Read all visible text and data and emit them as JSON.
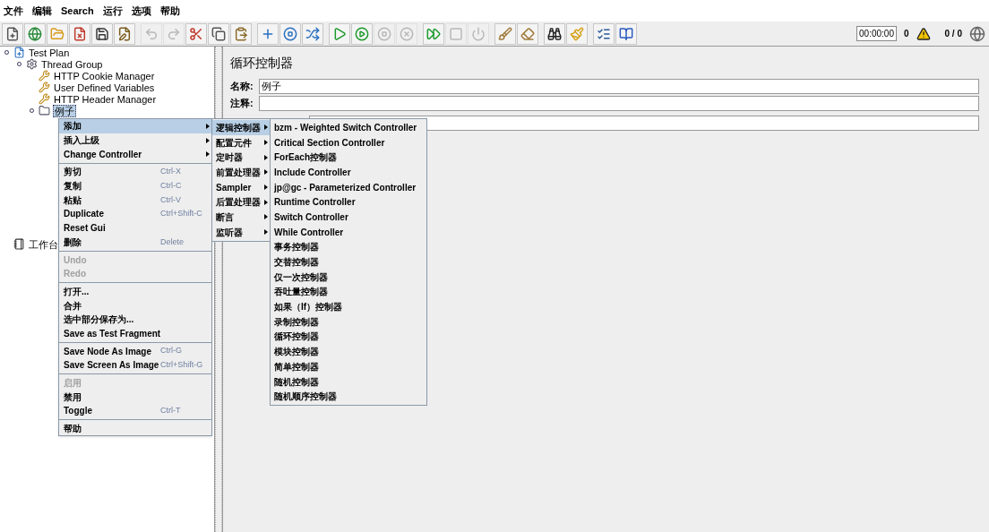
{
  "menu_bar": [
    {
      "label": "文件"
    },
    {
      "label": "编辑"
    },
    {
      "label": "Search"
    },
    {
      "label": "运行"
    },
    {
      "label": "选项"
    },
    {
      "label": "帮助"
    }
  ],
  "toolbar": [
    [
      {
        "kind": "new",
        "disabled": false
      },
      {
        "kind": "templates",
        "disabled": false
      },
      {
        "kind": "open",
        "disabled": false
      },
      {
        "kind": "close",
        "disabled": false
      },
      {
        "kind": "save",
        "disabled": false
      },
      {
        "kind": "save-as",
        "disabled": false
      }
    ],
    [
      {
        "kind": "undo",
        "disabled": true
      },
      {
        "kind": "redo",
        "disabled": true
      },
      {
        "kind": "cut",
        "disabled": false
      },
      {
        "kind": "copy",
        "disabled": false
      },
      {
        "kind": "paste",
        "disabled": false
      }
    ],
    [
      {
        "kind": "expand",
        "disabled": false
      },
      {
        "kind": "collapse",
        "disabled": false
      },
      {
        "kind": "toggle",
        "disabled": false
      }
    ],
    [
      {
        "kind": "start",
        "disabled": false
      },
      {
        "kind": "start-no-pause",
        "disabled": false
      },
      {
        "kind": "stop",
        "disabled": true
      },
      {
        "kind": "shutdown",
        "disabled": true
      }
    ],
    [
      {
        "kind": "remote-start",
        "disabled": false
      },
      {
        "kind": "remote-stop",
        "disabled": true
      },
      {
        "kind": "remote-exit",
        "disabled": true
      }
    ],
    [
      {
        "kind": "clear",
        "disabled": false
      },
      {
        "kind": "clear-all",
        "disabled": false
      }
    ],
    [
      {
        "kind": "search",
        "disabled": false
      },
      {
        "kind": "reset-search",
        "disabled": false
      }
    ],
    [
      {
        "kind": "function-helper",
        "disabled": false
      },
      {
        "kind": "help",
        "disabled": false
      }
    ]
  ],
  "status": {
    "timer": "00:00:00",
    "warnings": "0",
    "threads": "0 / 0"
  },
  "tree": [
    {
      "label": "Test Plan",
      "kind": "testplan",
      "expanded": true,
      "selected": false,
      "children": [
        {
          "label": "Thread Group",
          "kind": "threadgroup",
          "expanded": true,
          "selected": false,
          "children": [
            {
              "label": "HTTP Cookie Manager",
              "kind": "config",
              "expanded": false,
              "selected": false
            },
            {
              "label": "User Defined Variables",
              "kind": "config",
              "expanded": false,
              "selected": false
            },
            {
              "label": "HTTP Header Manager",
              "kind": "config",
              "expanded": false,
              "selected": false
            },
            {
              "label": "例子",
              "kind": "controller",
              "expanded": true,
              "selected": true
            }
          ]
        }
      ]
    },
    {
      "label": "工作台",
      "kind": "workbench",
      "expanded": false,
      "selected": false
    }
  ],
  "panel": {
    "title": "循环控制器",
    "name_label": "名称:",
    "name_value": "例子",
    "comment_label": "注释:"
  },
  "context_menu": [
    {
      "kind": "item",
      "label": "添加",
      "submenu": true,
      "disabled": false,
      "selected": true
    },
    {
      "kind": "item",
      "label": "插入上级",
      "submenu": true,
      "disabled": false,
      "selected": false
    },
    {
      "kind": "item",
      "label": "Change Controller",
      "submenu": true,
      "disabled": false,
      "selected": false
    },
    {
      "kind": "separator"
    },
    {
      "kind": "item",
      "label": "剪切",
      "shortcut": "Ctrl-X",
      "submenu": false,
      "disabled": false,
      "selected": false
    },
    {
      "kind": "item",
      "label": "复制",
      "shortcut": "Ctrl-C",
      "submenu": false,
      "disabled": false,
      "selected": false
    },
    {
      "kind": "item",
      "label": "粘贴",
      "shortcut": "Ctrl-V",
      "submenu": false,
      "disabled": false,
      "selected": false
    },
    {
      "kind": "item",
      "label": "Duplicate",
      "shortcut": "Ctrl+Shift-C",
      "submenu": false,
      "disabled": false,
      "selected": false
    },
    {
      "kind": "item",
      "label": "Reset Gui",
      "submenu": false,
      "disabled": false,
      "selected": false
    },
    {
      "kind": "item",
      "label": "删除",
      "shortcut": "Delete",
      "submenu": false,
      "disabled": false,
      "selected": false
    },
    {
      "kind": "separator"
    },
    {
      "kind": "item",
      "label": "Undo",
      "submenu": false,
      "disabled": true,
      "selected": false
    },
    {
      "kind": "item",
      "label": "Redo",
      "submenu": false,
      "disabled": true,
      "selected": false
    },
    {
      "kind": "separator"
    },
    {
      "kind": "item",
      "label": "打开...",
      "submenu": false,
      "disabled": false,
      "selected": false
    },
    {
      "kind": "item",
      "label": "合并",
      "submenu": false,
      "disabled": false,
      "selected": false
    },
    {
      "kind": "item",
      "label": "选中部分保存为...",
      "submenu": false,
      "disabled": false,
      "selected": false
    },
    {
      "kind": "item",
      "label": "Save as Test Fragment",
      "submenu": false,
      "disabled": false,
      "selected": false
    },
    {
      "kind": "separator"
    },
    {
      "kind": "item",
      "label": "Save Node As Image",
      "shortcut": "Ctrl-G",
      "submenu": false,
      "disabled": false,
      "selected": false
    },
    {
      "kind": "item",
      "label": "Save Screen As Image",
      "shortcut": "Ctrl+Shift-G",
      "submenu": false,
      "disabled": false,
      "selected": false
    },
    {
      "kind": "separator"
    },
    {
      "kind": "item",
      "label": "启用",
      "submenu": false,
      "disabled": true,
      "selected": false
    },
    {
      "kind": "item",
      "label": "禁用",
      "submenu": false,
      "disabled": false,
      "selected": false
    },
    {
      "kind": "item",
      "label": "Toggle",
      "shortcut": "Ctrl-T",
      "submenu": false,
      "disabled": false,
      "selected": false
    },
    {
      "kind": "separator"
    },
    {
      "kind": "item",
      "label": "帮助",
      "submenu": false,
      "disabled": false,
      "selected": false
    }
  ],
  "add_submenu": [
    {
      "label": "逻辑控制器",
      "selected": true
    },
    {
      "label": "配置元件",
      "selected": false
    },
    {
      "label": "定时器",
      "selected": false
    },
    {
      "label": "前置处理器",
      "selected": false
    },
    {
      "label": "Sampler",
      "selected": false
    },
    {
      "label": "后置处理器",
      "selected": false
    },
    {
      "label": "断言",
      "selected": false
    },
    {
      "label": "监听器",
      "selected": false
    }
  ],
  "logic_controller_submenu": [
    {
      "label": "bzm - Weighted Switch Controller"
    },
    {
      "label": "Critical Section Controller"
    },
    {
      "label": "ForEach控制器"
    },
    {
      "label": "Include Controller"
    },
    {
      "label": "jp@gc - Parameterized Controller"
    },
    {
      "label": "Runtime Controller"
    },
    {
      "label": "Switch Controller"
    },
    {
      "label": "While Controller"
    },
    {
      "label": "事务控制器"
    },
    {
      "label": "交替控制器"
    },
    {
      "label": "仅一次控制器"
    },
    {
      "label": "吞吐量控制器"
    },
    {
      "label": "如果（If）控制器"
    },
    {
      "label": "录制控制器"
    },
    {
      "label": "循环控制器"
    },
    {
      "label": "模块控制器"
    },
    {
      "label": "简单控制器"
    },
    {
      "label": "随机控制器"
    },
    {
      "label": "随机顺序控制器"
    }
  ]
}
